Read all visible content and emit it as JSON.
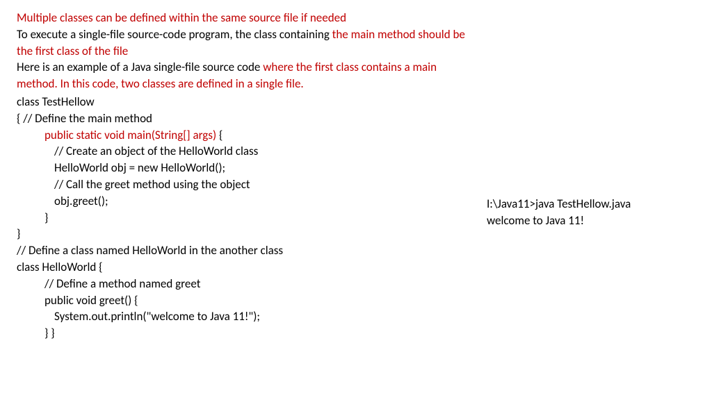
{
  "intro": {
    "line1_red": "Multiple classes can be defined within the same source file if needed",
    "line2_black": "To execute a single-file source-code program, the class containing ",
    "line2_red": "the main method should be the first class of the file",
    "line3_black": " Here is an example of a Java single-file source code ",
    "line3_red": "where the first class contains a main method. In this code, two classes are defined in a single file."
  },
  "code": {
    "c1": "class TestHellow",
    "c2a": "{    ",
    "c2b": "// Define the main method",
    "c3_red": "public static void main(String[] args) ",
    "c3_black": "{",
    "c4": "// Create an object of the HelloWorld class",
    "c5": "HelloWorld obj = new HelloWorld();",
    "c6": "// Call the greet method using the object",
    "c7": "obj.greet();",
    "c8": "}",
    "c9": "}",
    "c10": "// Define a class named HelloWorld in the  another  class",
    "c11": " class HelloWorld {",
    "c12": "// Define a method named greet",
    "c13": "public void greet() {",
    "c14": "System.out.println(\"welcome to Java 11!\");",
    "c15": "} }"
  },
  "output": {
    "line1": "I:\\Java11>java TestHellow.java",
    "line2": "welcome to Java 11!"
  }
}
